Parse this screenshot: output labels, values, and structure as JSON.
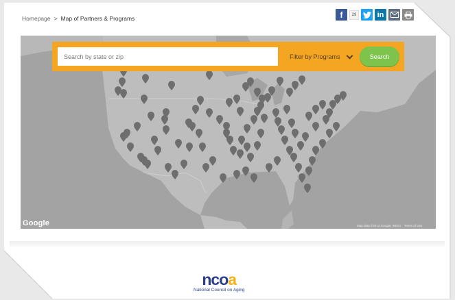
{
  "breadcrumb": {
    "home": "Homepage",
    "separator": ">",
    "current": "Map of Partners & Programs"
  },
  "social": {
    "facebook_icon": "f",
    "share_count": "29",
    "twitter_icon": "twitter-bird",
    "linkedin_icon": "in",
    "email_icon": "envelope",
    "print_icon": "printer"
  },
  "search": {
    "placeholder": "Search by state or zip",
    "filter_label": "Filter by Programs",
    "button_label": "Search"
  },
  "map": {
    "provider_label": "Google",
    "credits": "Map data ©2014 Google, INEGI",
    "terms": "Terms of Use"
  },
  "footer": {
    "logo_text_1": "nco",
    "logo_text_2": "a",
    "logo_sub": "National Council on Aging"
  },
  "colors": {
    "accent": "#f4a623",
    "search_button": "#7dc34c",
    "map_bg": "#a3a3a3",
    "land": "#bdbdbd",
    "pin": "#6e6e6e"
  }
}
